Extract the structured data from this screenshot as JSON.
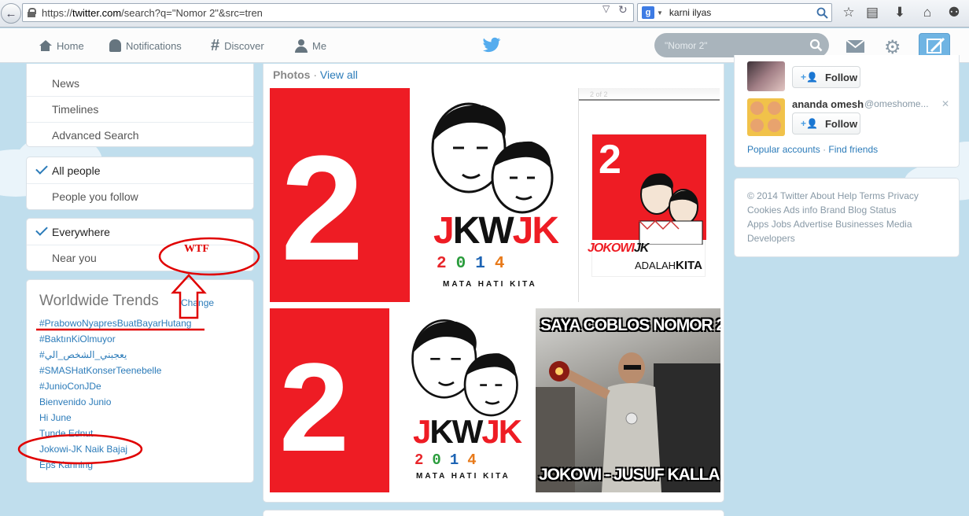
{
  "browser": {
    "url_scheme": "https://",
    "url_host": "twitter.com",
    "url_path": "/search?q=\"Nomor 2\"&src=tren",
    "search_value": "karni ilyas"
  },
  "topnav": {
    "home": "Home",
    "notifications": "Notifications",
    "discover": "Discover",
    "me": "Me",
    "search_placeholder": "\"Nomor 2\""
  },
  "left": {
    "menu": [
      "News",
      "Timelines",
      "Advanced Search"
    ],
    "people_filter": [
      "All people",
      "People you follow"
    ],
    "location_filter": [
      "Everywhere",
      "Near you"
    ],
    "trends_title": "Worldwide Trends",
    "trends_change": "Change",
    "trends": [
      "#PrabowoNyapresBuatBayarHutang",
      "#BaktınKiOlmuyor",
      "#يعجبني_الشخص_الي",
      "#SMASHatKonserTeenebelle",
      "#JunioConJDe",
      "Bienvenido Junio",
      "Hi June",
      "Tunde Ednut",
      "Jokowi-JK Naik Bajaj",
      "Eps Kanning"
    ]
  },
  "annotation": {
    "wtf": "WTF"
  },
  "center": {
    "photos_label": "Photos",
    "separator": "·",
    "view_all": "View all",
    "tiles": {
      "big_two": "2",
      "logo_j": "J",
      "logo_kw": "KW",
      "logo_jk": "JK",
      "year": "2014",
      "slogan": "MATA HATI KITA",
      "page_indicator": "2 of 2",
      "jokowi": "JOKOWI",
      "jk": "JK",
      "adalah": "ADALAH",
      "kita": "KITA",
      "meme_top": "SAYA COBLOS NOMOR 2",
      "meme_bottom": "JOKOWI - JUSUF KALLA"
    }
  },
  "right": {
    "follow_label": "Follow",
    "suggestion_name": "ananda omesh",
    "suggestion_handle": "@omeshome...",
    "dismiss": "✕",
    "popular_accounts": "Popular accounts",
    "find_friends": "Find friends",
    "footer_lines": [
      [
        "© 2014 Twitter",
        "About",
        "Help",
        "Terms",
        "Privacy"
      ],
      [
        "Cookies",
        "Ads info",
        "Brand",
        "Blog",
        "Status"
      ],
      [
        "Apps",
        "Jobs",
        "Advertise",
        "Businesses",
        "Media"
      ],
      [
        "Developers"
      ]
    ]
  },
  "colors": {
    "twitter_blue": "#2b7bb9",
    "brand_red": "#ee1c24",
    "annotation_red": "#e00000",
    "background": "#c0deed"
  }
}
